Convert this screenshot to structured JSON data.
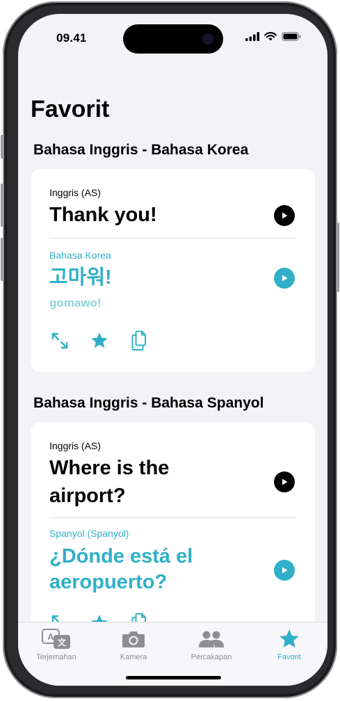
{
  "status": {
    "time": "09.41"
  },
  "page": {
    "title": "Favorit"
  },
  "sections": [
    {
      "title": "Bahasa Inggris - Bahasa Korea",
      "source_label": "Inggris (AS)",
      "source_text": "Thank you!",
      "target_label": "Bahasa Korea",
      "target_text": "고마워!",
      "romanization": "gomawo!"
    },
    {
      "title": "Bahasa Inggris - Bahasa Spanyol",
      "source_label": "Inggris (AS)",
      "source_text": "Where is the\nairport?",
      "target_label": "Spanyol (Spanyol)",
      "target_text": "¿Dónde está el\naeropuerto?"
    }
  ],
  "tabs": [
    {
      "label": "Terjemahan",
      "icon": "translate-icon"
    },
    {
      "label": "Kamera",
      "icon": "camera-icon"
    },
    {
      "label": "Percakapan",
      "icon": "people-icon"
    },
    {
      "label": "Favorit",
      "icon": "star-icon",
      "active": true
    }
  ],
  "colors": {
    "accent": "#2fb0c8",
    "background": "#f2f2f7"
  }
}
